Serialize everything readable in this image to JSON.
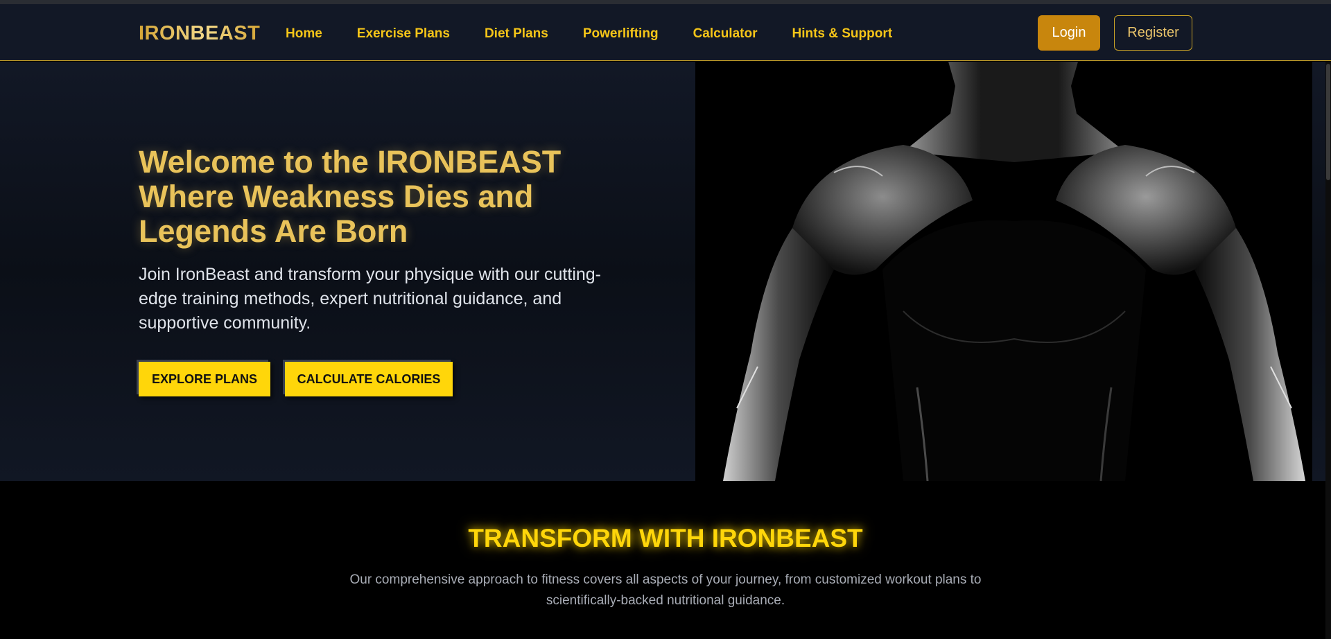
{
  "brand": {
    "logo": "IRONBEAST"
  },
  "nav": {
    "links": [
      "Home",
      "Exercise Plans",
      "Diet Plans",
      "Powerlifting",
      "Calculator",
      "Hints & Support"
    ],
    "login": "Login",
    "register": "Register"
  },
  "hero": {
    "title_line1": "Welcome to the IRONBEAST",
    "title_line2": "Where Weakness Dies and",
    "title_line3": "Legends Are Born",
    "description": "Join IronBeast and transform your physique with our cutting-edge training methods, expert nutritional guidance, and supportive community.",
    "explore_button": "EXPLORE PLANS",
    "calculate_button": "CALCULATE CALORIES"
  },
  "features": {
    "title": "TRANSFORM WITH IRONBEAST",
    "description": "Our comprehensive approach to fitness covers all aspects of your journey, from customized workout plans to scientifically-backed nutritional guidance."
  },
  "colors": {
    "accent": "#ffd60a",
    "gold": "#e9c35a",
    "nav_background": "#121826",
    "login_background": "#c8860d"
  }
}
